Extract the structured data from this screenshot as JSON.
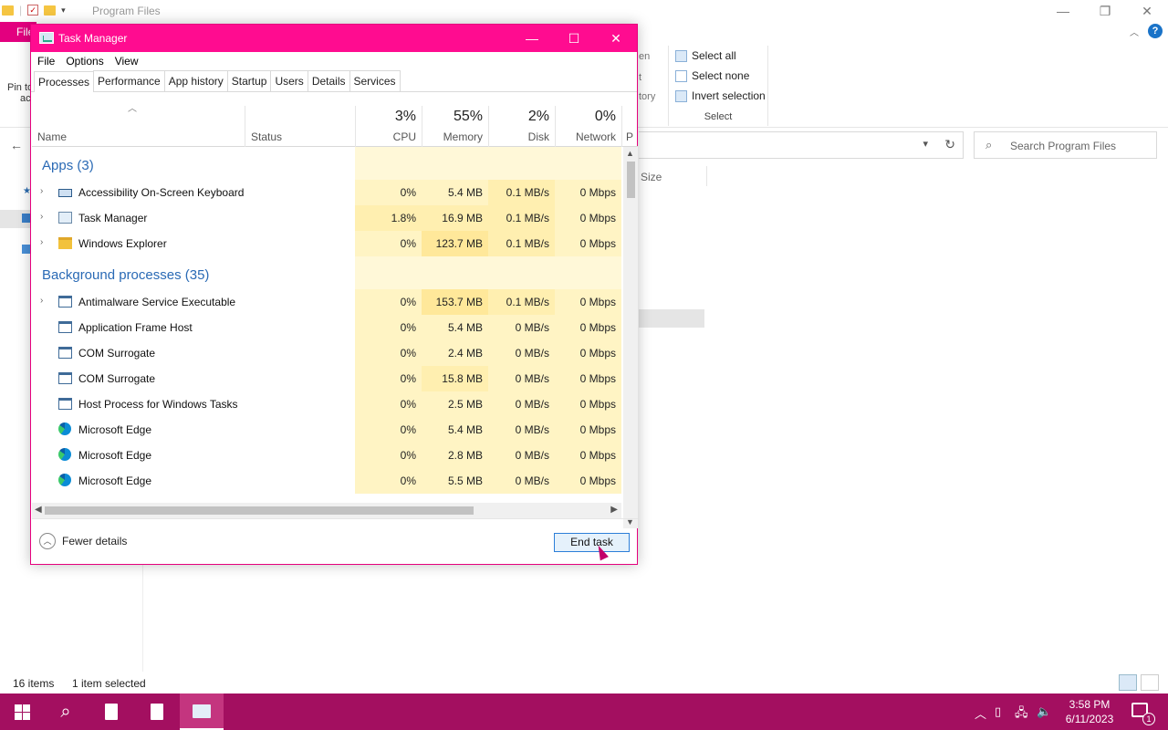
{
  "explorer": {
    "title": "Program Files",
    "file_tab": "File",
    "ribbon": {
      "pin_text_1": "Pin to",
      "pin_text_2": "ac",
      "partial_1": "en",
      "partial_2": "t",
      "partial_3": "tory",
      "select_all": "Select all",
      "select_none": "Select none",
      "invert_selection": "Invert selection",
      "group_label": "Select"
    },
    "search_placeholder": "Search Program Files",
    "column_size": "Size",
    "status": {
      "items": "16 items",
      "selected": "1 item selected"
    }
  },
  "task_manager": {
    "title": "Task Manager",
    "menu": [
      "File",
      "Options",
      "View"
    ],
    "tabs": [
      "Processes",
      "Performance",
      "App history",
      "Startup",
      "Users",
      "Details",
      "Services"
    ],
    "active_tab": "Processes",
    "columns": {
      "name": "Name",
      "status": "Status",
      "cpu": {
        "pct": "3%",
        "label": "CPU"
      },
      "memory": {
        "pct": "55%",
        "label": "Memory"
      },
      "disk": {
        "pct": "2%",
        "label": "Disk"
      },
      "network": {
        "pct": "0%",
        "label": "Network"
      },
      "partial": "P"
    },
    "groups": {
      "apps": "Apps (3)",
      "background": "Background processes (35)"
    },
    "apps": [
      {
        "name": "Accessibility On-Screen Keyboard",
        "cpu": "0%",
        "memory": "5.4 MB",
        "disk": "0.1 MB/s",
        "network": "0 Mbps",
        "icon": "keyboard-icon"
      },
      {
        "name": "Task Manager",
        "cpu": "1.8%",
        "memory": "16.9 MB",
        "disk": "0.1 MB/s",
        "network": "0 Mbps",
        "icon": "task-manager-icon"
      },
      {
        "name": "Windows Explorer",
        "cpu": "0%",
        "memory": "123.7 MB",
        "disk": "0.1 MB/s",
        "network": "0 Mbps",
        "icon": "folder-icon"
      }
    ],
    "background": [
      {
        "name": "Antimalware Service Executable",
        "cpu": "0%",
        "memory": "153.7 MB",
        "disk": "0.1 MB/s",
        "network": "0 Mbps",
        "icon": "window-icon"
      },
      {
        "name": "Application Frame Host",
        "cpu": "0%",
        "memory": "5.4 MB",
        "disk": "0 MB/s",
        "network": "0 Mbps",
        "icon": "window-icon"
      },
      {
        "name": "COM Surrogate",
        "cpu": "0%",
        "memory": "2.4 MB",
        "disk": "0 MB/s",
        "network": "0 Mbps",
        "icon": "window-icon"
      },
      {
        "name": "COM Surrogate",
        "cpu": "0%",
        "memory": "15.8 MB",
        "disk": "0 MB/s",
        "network": "0 Mbps",
        "icon": "window-icon"
      },
      {
        "name": "Host Process for Windows Tasks",
        "cpu": "0%",
        "memory": "2.5 MB",
        "disk": "0 MB/s",
        "network": "0 Mbps",
        "icon": "window-icon"
      },
      {
        "name": "Microsoft Edge",
        "cpu": "0%",
        "memory": "5.4 MB",
        "disk": "0 MB/s",
        "network": "0 Mbps",
        "icon": "edge-icon"
      },
      {
        "name": "Microsoft Edge",
        "cpu": "0%",
        "memory": "2.8 MB",
        "disk": "0 MB/s",
        "network": "0 Mbps",
        "icon": "edge-icon"
      },
      {
        "name": "Microsoft Edge",
        "cpu": "0%",
        "memory": "5.5 MB",
        "disk": "0 MB/s",
        "network": "0 Mbps",
        "icon": "edge-icon"
      }
    ],
    "footer": {
      "fewer_details": "Fewer details",
      "end_task": "End task"
    }
  },
  "taskbar": {
    "time": "3:58 PM",
    "date": "6/11/2023",
    "notification_count": "1"
  },
  "colors": {
    "accent": "#ff0c90",
    "taskbar": "#a30f60",
    "group_text": "#2a6ab5"
  }
}
